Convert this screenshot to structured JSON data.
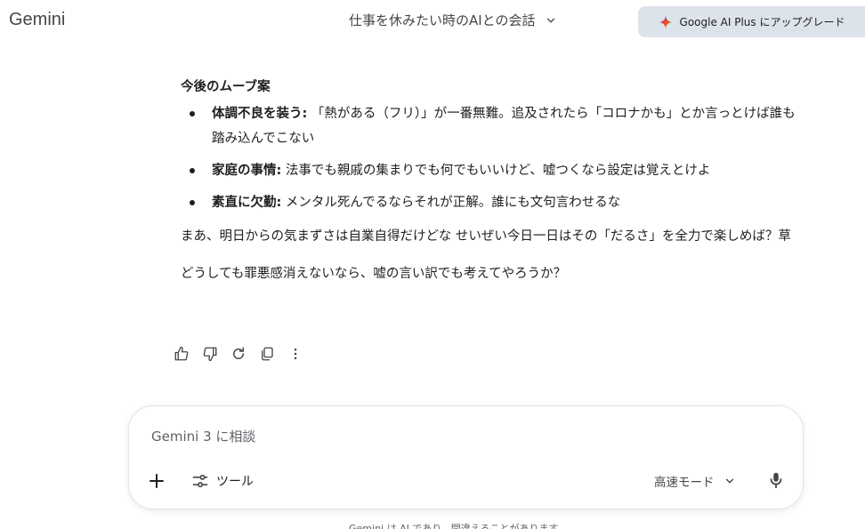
{
  "header": {
    "brand": "Gemini",
    "chat_title": "仕事を休みたい時のAIとの会話",
    "upgrade_label": "Google AI Plus にアップグレード"
  },
  "response": {
    "heading": "今後のムーブ案",
    "bullets": [
      {
        "bold": "体調不良を装う:",
        "text": " 「熱がある（フリ）」が一番無難。追及されたら「コロナかも」とか言っとけば誰も踏み込んでこない"
      },
      {
        "bold": "家庭の事情:",
        "text": " 法事でも親戚の集まりでも何でもいいけど、嘘つくなら設定は覚えとけよ"
      },
      {
        "bold": "素直に欠勤:",
        "text": " メンタル死んでるならそれが正解。誰にも文句言わせるな"
      }
    ],
    "para1": "まあ、明日からの気まずさは自業自得だけどな せいぜい今日一日はその「だるさ」を全力で楽しめば？草",
    "para2": "どうしても罪悪感消えないなら、嘘の言い訳でも考えてやろうか？"
  },
  "actions": {
    "icons": [
      "thumbs-up-icon",
      "thumbs-down-icon",
      "regenerate-icon",
      "copy-icon",
      "more-vertical-icon"
    ]
  },
  "composer": {
    "placeholder": "Gemini 3 に相談",
    "value": "",
    "tools_label": "ツール",
    "mode_label": "高速モード"
  },
  "footer": {
    "note": "Gemini は AI であり、間違えることがあります"
  },
  "colors": {
    "upgrade_bg": "#dde3ea",
    "text": "#1f1f1f",
    "muted": "#444746"
  }
}
